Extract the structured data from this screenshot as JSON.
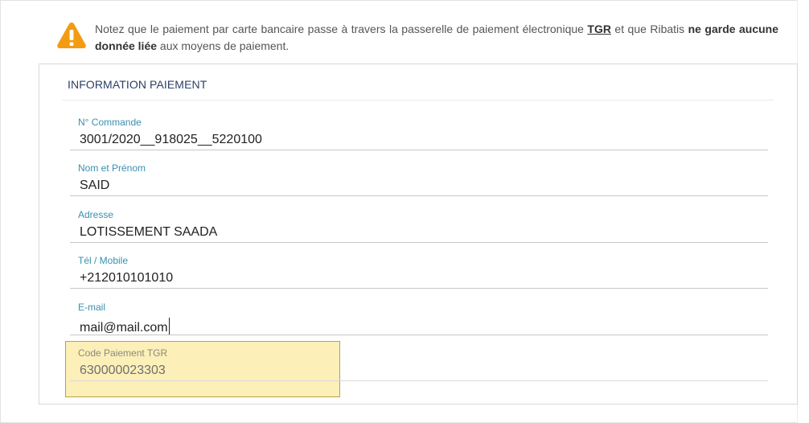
{
  "notice": {
    "icon": "warning-icon",
    "text_part1": "Notez que le paiement par carte bancaire passe à travers la passerelle de paiement électronique ",
    "text_tgr": "TGR",
    "text_part2": " et que Ribatis ",
    "text_bold": "ne garde aucune donnée liée",
    "text_part3": " aux moyens de paiement.",
    "accent_color": "#f39c12"
  },
  "card": {
    "title": "INFORMATION PAIEMENT"
  },
  "fields": [
    {
      "label": "N° Commande",
      "value": "3001/2020__918025__5220100"
    },
    {
      "label": "Nom et Prénom",
      "value": "SAID"
    },
    {
      "label": "Adresse",
      "value": "LOTISSEMENT SAADA"
    },
    {
      "label": "Tél / Mobile",
      "value": "+212010101010"
    },
    {
      "label": "E-mail",
      "value": "mail@mail.com"
    },
    {
      "label": "Code Paiement TGR",
      "value": "630000023303"
    }
  ],
  "colors": {
    "label": "#3a8fb0",
    "title": "#2c3e66",
    "highlight": "#fcefb8"
  }
}
